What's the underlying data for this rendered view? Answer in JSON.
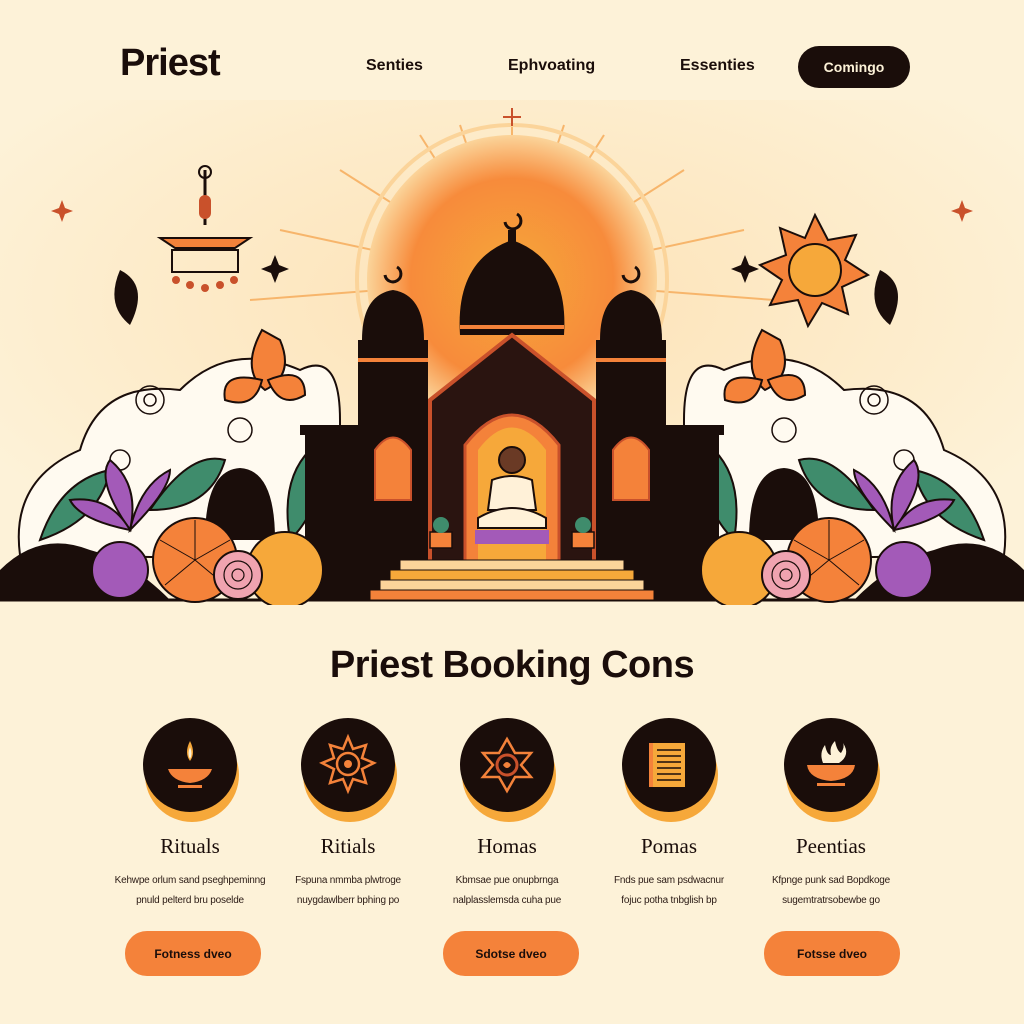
{
  "nav": {
    "logo": "Priest",
    "links": [
      "Senties",
      "Ephvoating",
      "Essenties"
    ],
    "cta_label": "Comingo"
  },
  "section": {
    "title": "Priest Booking Cons"
  },
  "cards": [
    {
      "title": "Rituals",
      "icon": "diya-icon",
      "desc": [
        "Kehwpe orlum sand pseghpeminng",
        "pnuld pelterd bru poselde"
      ]
    },
    {
      "title": "Ritials",
      "icon": "mandala-sun-icon",
      "desc": [
        "Fspuna nmmba plwtroge",
        "nuygdawlberr bphing po"
      ]
    },
    {
      "title": "Homas",
      "icon": "lotus-mandala-icon",
      "desc": [
        "Kbmsae pue onupbrnga",
        "nalplasslemsda cuha pue"
      ]
    },
    {
      "title": "Pomas",
      "icon": "scroll-icon",
      "desc": [
        "Fnds pue sam psdwacnur",
        "fojuc potha tnbglish bp"
      ]
    },
    {
      "title": "Peentias",
      "icon": "fire-bowl-icon",
      "desc": [
        "Kfpnge punk sad Bopdkoge",
        "sugemtratrsobewbe go"
      ]
    }
  ],
  "buttons": [
    "Fotness dveo",
    "Sdotse dveo",
    "Fotsse dveo"
  ],
  "colors": {
    "background": "#fdf2d8",
    "dark": "#1a0d0a",
    "accent_orange": "#f4823a",
    "sun_yellow": "#f6a83a",
    "purple": "#a35ab8",
    "leaf_green": "#3f8c6c"
  }
}
